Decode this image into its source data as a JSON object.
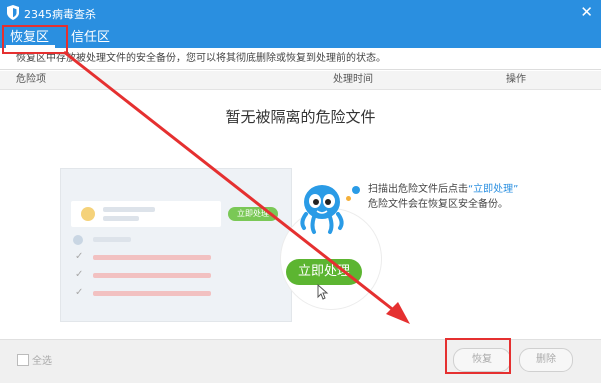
{
  "window": {
    "title": "2345病毒查杀",
    "close_icon": "close-icon"
  },
  "tabs": [
    {
      "label": "恢复区",
      "active": true
    },
    {
      "label": "信任区",
      "active": false
    }
  ],
  "info_text": "恢复区中存放被处理文件的安全备份，您可以将其彻底删除或恢复到处理前的状态。",
  "columns": {
    "item": "危险项",
    "time": "处理时间",
    "action": "操作"
  },
  "empty": {
    "title": "暂无被隔离的危险文件",
    "illustration_small_button": "立即处理",
    "illustration_big_button": "立即处理",
    "hint_prefix": "扫描出危险文件后点击",
    "hint_link": "“立即处理”",
    "hint_line2": "危险文件会在恢复区安全备份。"
  },
  "footer": {
    "select_all": "全选",
    "restore_button": "恢复",
    "delete_button": "删除"
  },
  "colors": {
    "accent": "#2a8fe0",
    "green": "#5cb531",
    "annotation_red": "#e53030"
  }
}
